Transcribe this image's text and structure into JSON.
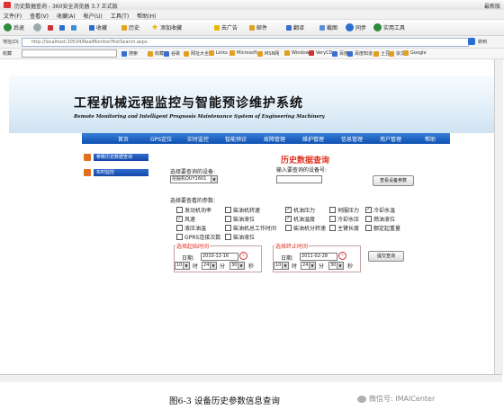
{
  "browser": {
    "window_title": "历史数据查询 - 360安全浏览器 3.7 正式版",
    "right_label": "最新版",
    "menu": [
      "文件(F)",
      "查看(V)",
      "收藏(A)",
      "帐户(U)",
      "工具(T)",
      "帮助(H)"
    ],
    "toolbar": {
      "back": "后退",
      "forward": "",
      "favorites": "收藏",
      "history": "历史",
      "add_fav": "添加收藏",
      "ads": "去广告",
      "mail": "邮件",
      "translate": "翻译",
      "screenshot": "截图",
      "sync": "同步",
      "tools": "实用工具"
    },
    "address_label": "地址(D)",
    "address": "http://localhost:20534/RealMonitor/HistSearch.aspx",
    "go_label": "转到",
    "fav_label": "收藏",
    "search_label": "搜索",
    "favorites": [
      "收藏",
      "谷歌",
      "网址大全",
      "Links",
      "Microsoft",
      "MSN网",
      "Window",
      "VeryCD",
      "百度",
      "百度知道",
      "土豆",
      "杂文",
      "Google"
    ]
  },
  "site": {
    "title": "工程机械远程监控与智能预诊维护系统",
    "subtitle": "Remote Monitoring and Intelligent Prognosis Maintenance System of Engineering Machinery",
    "nav": [
      "首页",
      "GPS定位",
      "实时监控",
      "智能预诊",
      "故障管理",
      "维护管理",
      "信息管理",
      "用户管理",
      "帮助"
    ],
    "side": [
      "参数历史数据查询",
      "实时监控"
    ]
  },
  "query": {
    "title": "历史数据查询",
    "device_label": "选择要查询的设备:",
    "device_value": "挖掘机QUY1601",
    "device_no_label": "输入要查询的设备号:",
    "device_no_value": "",
    "query_device_btn": "查看设备参数",
    "params_label": "选择要查看的参数:",
    "params": [
      {
        "label": "发动机功率",
        "checked": false
      },
      {
        "label": "柴油机转速",
        "checked": false
      },
      {
        "label": "机油压力",
        "checked": true
      },
      {
        "label": "伺服压力",
        "checked": false
      },
      {
        "label": "冷却水温",
        "checked": true
      },
      {
        "label": "风速",
        "checked": true
      },
      {
        "label": "柴油液位",
        "checked": false
      },
      {
        "label": "机油温度",
        "checked": true
      },
      {
        "label": "冷却水压",
        "checked": false
      },
      {
        "label": "燃油液位",
        "checked": false
      },
      {
        "label": "液压油温",
        "checked": false
      },
      {
        "label": "柴油机总工作时间",
        "checked": false
      },
      {
        "label": "柴油机分转速",
        "checked": false
      },
      {
        "label": "主臂长度",
        "checked": false
      },
      {
        "label": "额定起重量",
        "checked": false
      },
      {
        "label": "GPRS连接次数",
        "checked": false
      },
      {
        "label": "柴油液位",
        "checked": false
      }
    ],
    "start": {
      "legend": "选择起始时间",
      "date_label": "日期:",
      "date": "2010-12-16",
      "hour": "10",
      "hour_unit": "时",
      "minute": "24",
      "minute_unit": "分",
      "second": "30",
      "second_unit": "秒"
    },
    "end": {
      "legend": "选择终止时间",
      "date_label": "日期:",
      "date": "2011-02-28",
      "hour": "10",
      "hour_unit": "时",
      "minute": "24",
      "minute_unit": "分",
      "second": "30",
      "second_unit": "秒"
    },
    "submit_btn": "提交查询"
  },
  "caption": {
    "text": "图6-3 设备历史参数信息查询",
    "watermark": "微信号: IMAICenter"
  },
  "colors": {
    "nav": "#0c4fb1",
    "accent_red": "#e0301e",
    "side_flag": "#e07020"
  }
}
